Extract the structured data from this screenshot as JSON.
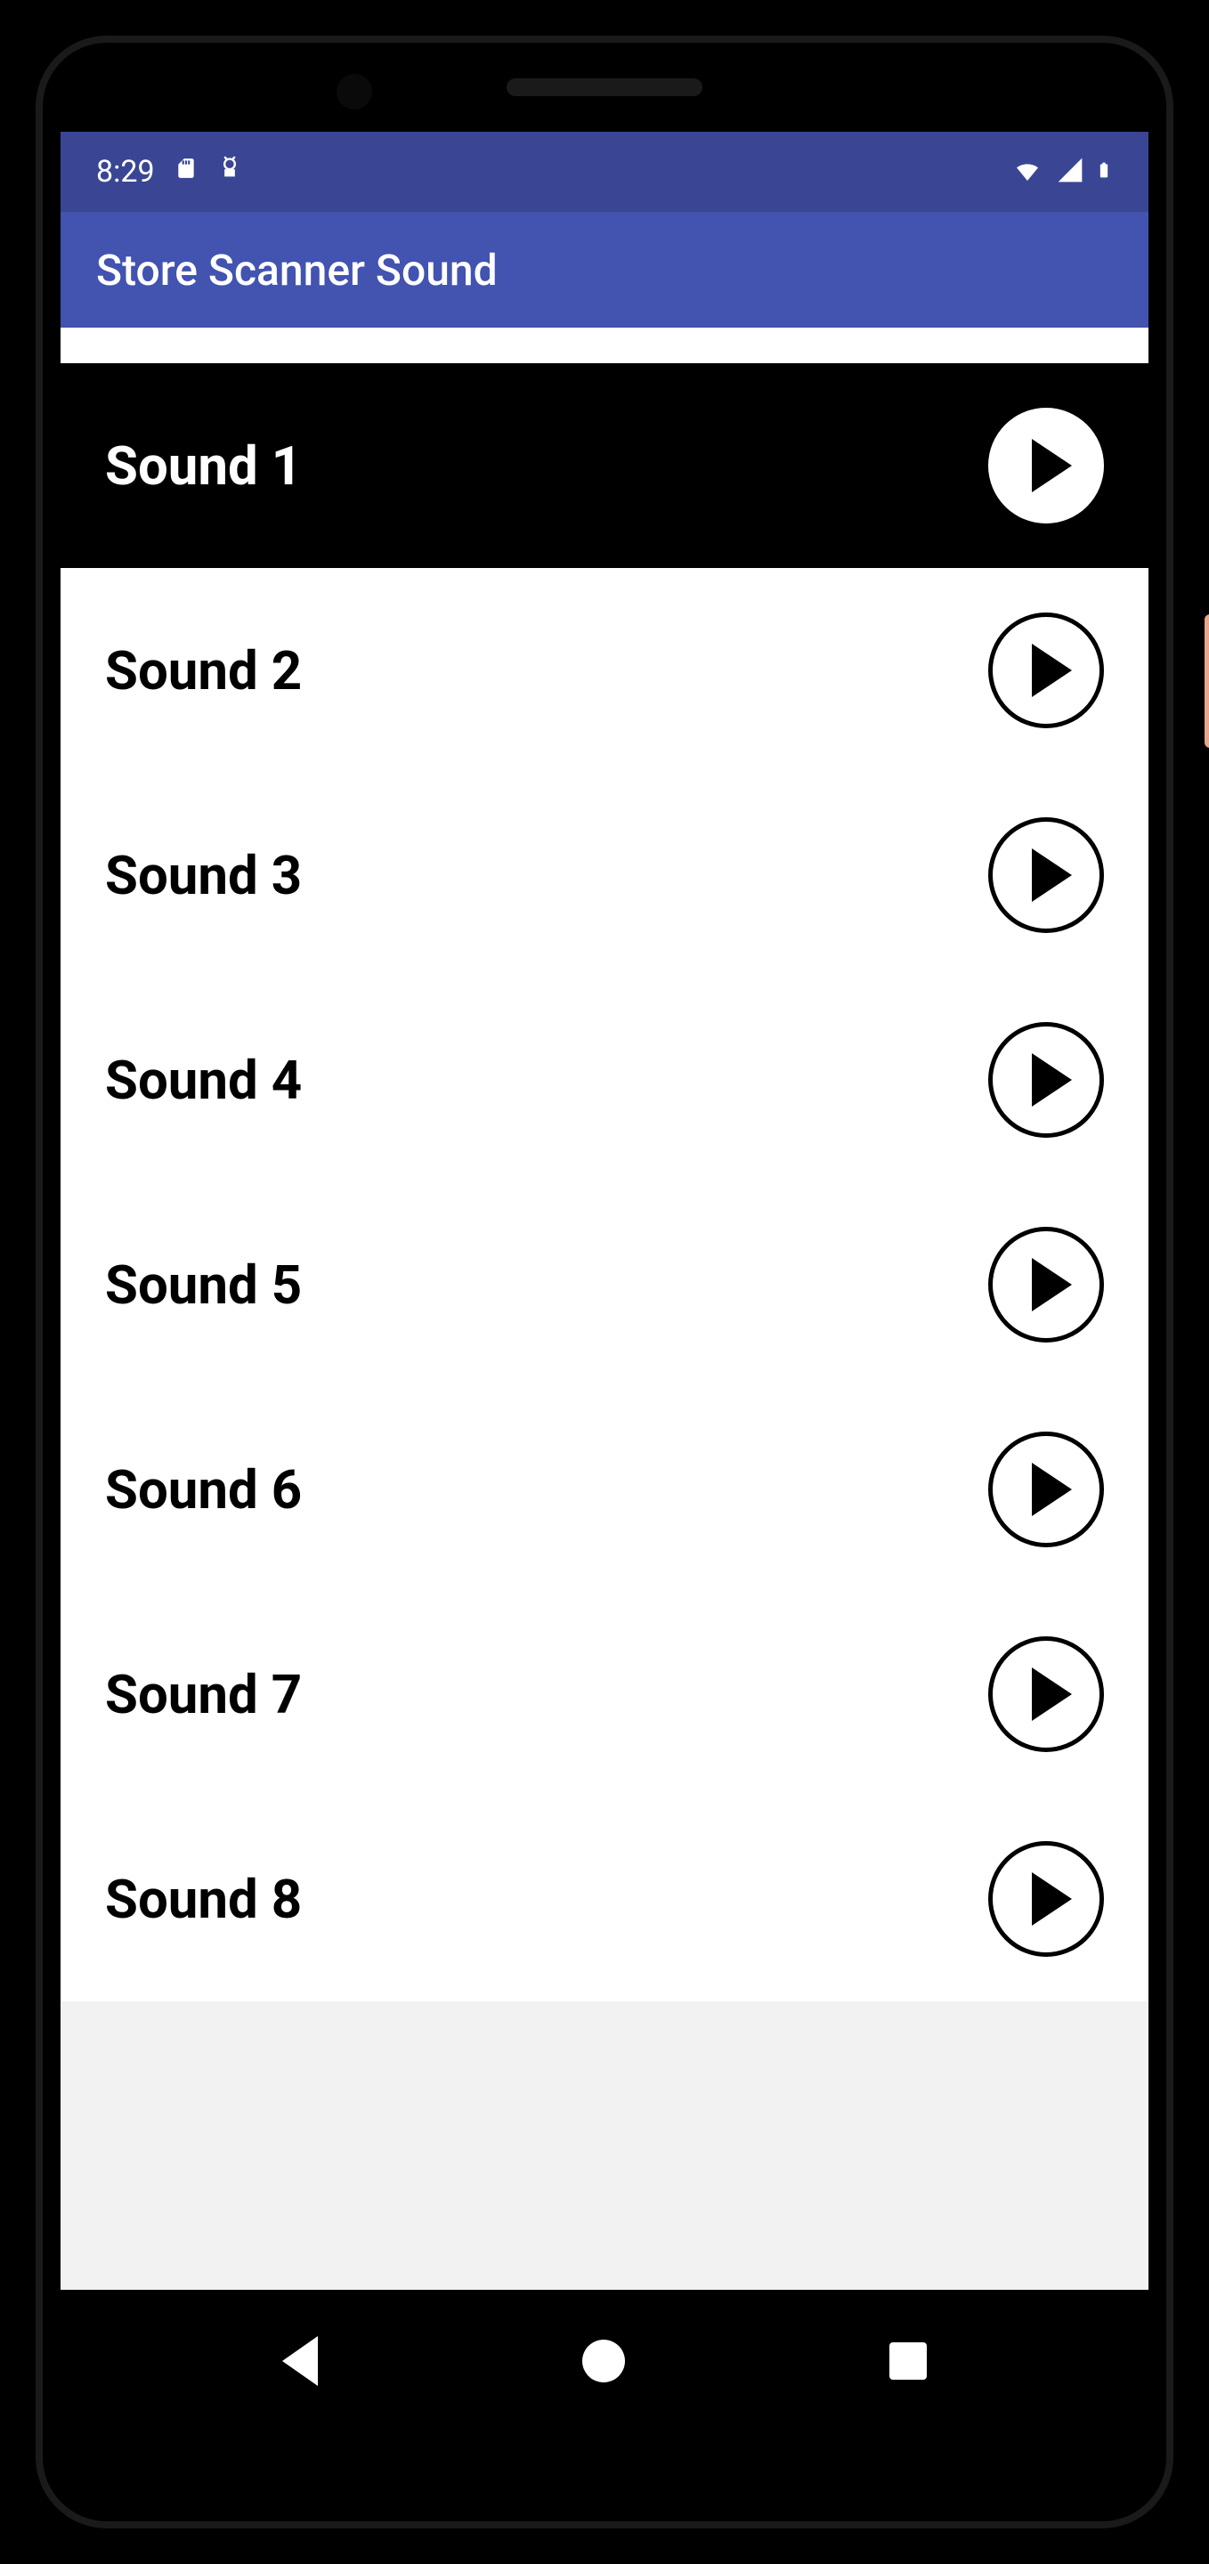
{
  "status": {
    "time": "8:29"
  },
  "app": {
    "title": "Store Scanner Sound"
  },
  "sounds": [
    {
      "label": "Sound 1",
      "selected": true
    },
    {
      "label": "Sound 2",
      "selected": false
    },
    {
      "label": "Sound 3",
      "selected": false
    },
    {
      "label": "Sound 4",
      "selected": false
    },
    {
      "label": "Sound 5",
      "selected": false
    },
    {
      "label": "Sound 6",
      "selected": false
    },
    {
      "label": "Sound 7",
      "selected": false
    },
    {
      "label": "Sound 8",
      "selected": false
    }
  ]
}
